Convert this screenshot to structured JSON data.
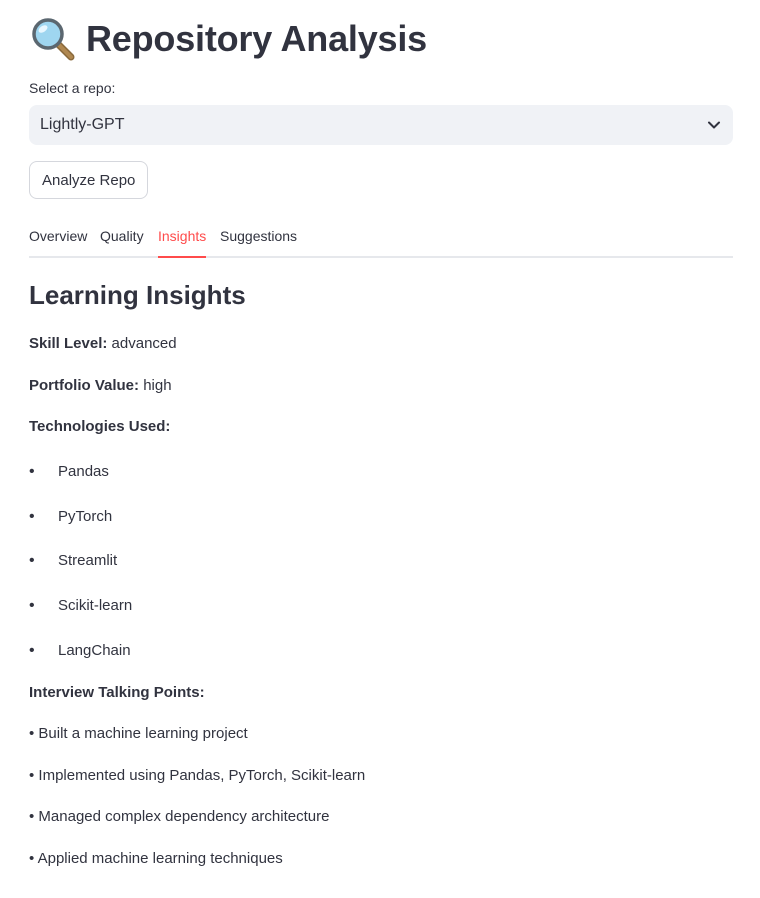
{
  "header": {
    "icon": "magnifying-glass-icon",
    "title": "Repository Analysis"
  },
  "repo_select": {
    "label": "Select a repo:",
    "value": "Lightly-GPT"
  },
  "analyze_button": {
    "label": "Analyze Repo"
  },
  "tabs": [
    {
      "label": "Overview",
      "active": false
    },
    {
      "label": "Quality",
      "active": false
    },
    {
      "label": "Insights",
      "active": true
    },
    {
      "label": "Suggestions",
      "active": false
    }
  ],
  "insights": {
    "title": "Learning Insights",
    "skill_level_label": "Skill Level:",
    "skill_level_value": "advanced",
    "portfolio_value_label": "Portfolio Value:",
    "portfolio_value_value": "high",
    "technologies_label": "Technologies Used:",
    "technologies": [
      "Pandas",
      "PyTorch",
      "Streamlit",
      "Scikit-learn",
      "LangChain"
    ],
    "talking_points_label": "Interview Talking Points:",
    "talking_points": [
      "• Built a machine learning project",
      "• Implemented using Pandas, PyTorch, Scikit-learn",
      "• Managed complex dependency architecture",
      "• Applied machine learning techniques"
    ]
  },
  "colors": {
    "accent": "#ff4b4b",
    "text": "#31333f",
    "select_bg": "#f0f2f6"
  }
}
